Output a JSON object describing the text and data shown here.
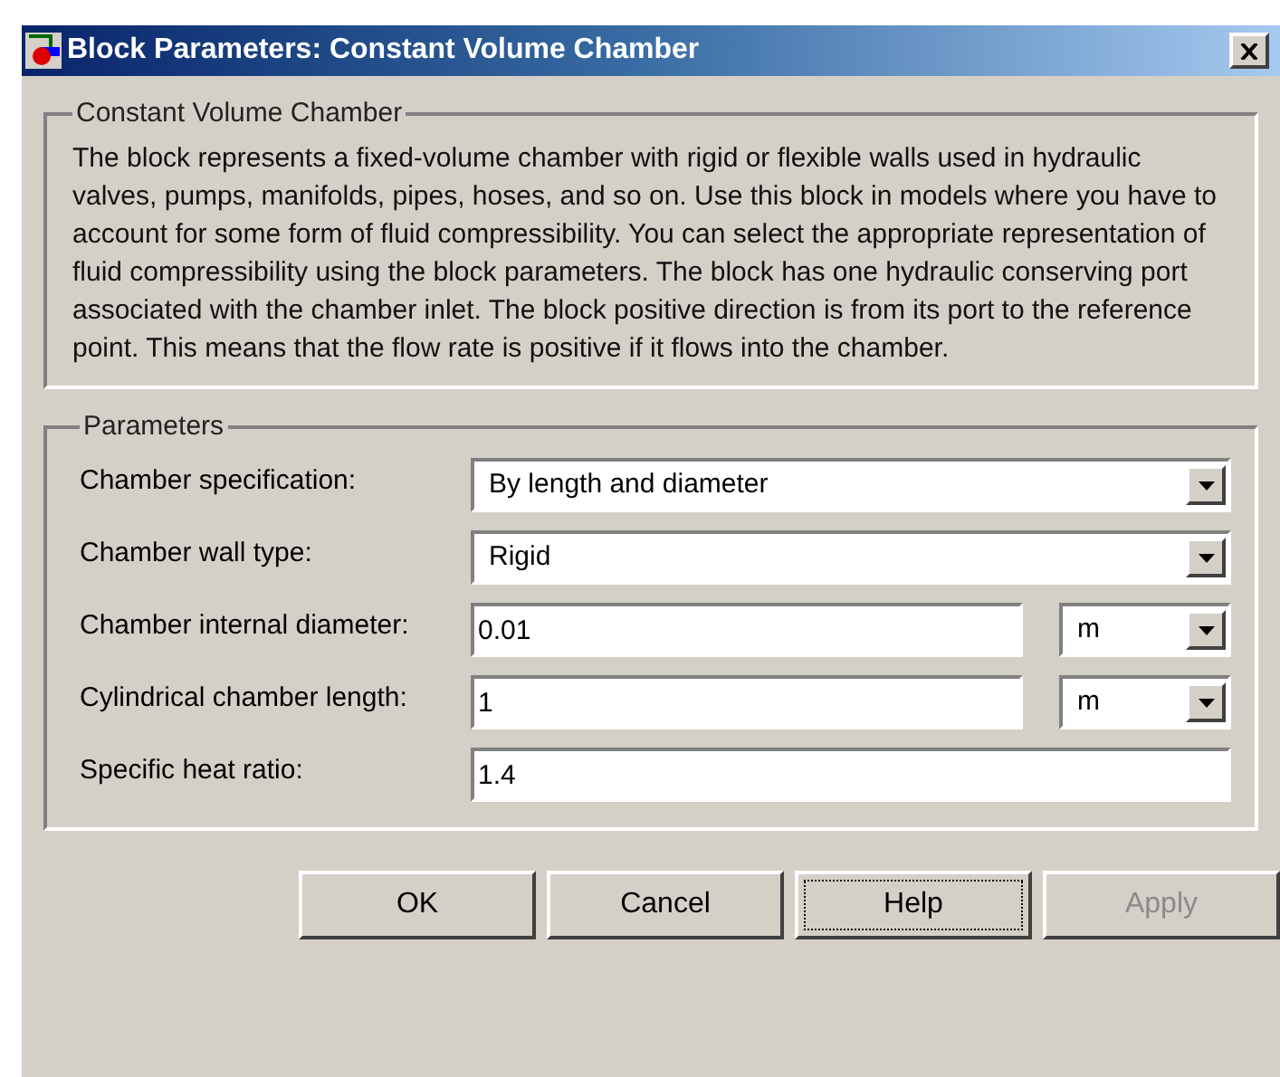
{
  "window": {
    "title": "Block Parameters: Constant Volume Chamber"
  },
  "description": {
    "title": "Constant Volume Chamber",
    "text": "The block represents a fixed-volume chamber with rigid or flexible walls used in hydraulic valves, pumps, manifolds, pipes, hoses, and so on. Use this block in models where you have to account for some form of fluid compressibility. You can select the appropriate representation of fluid compressibility using the block parameters. The block has one hydraulic conserving port associated with the chamber inlet. The block positive direction is from its port to the reference point. This means that the flow rate is positive if it flows into the chamber."
  },
  "parameters": {
    "title": "Parameters",
    "rows": [
      {
        "kind": "dropdown",
        "label": "Chamber specification:",
        "value": "By length and diameter"
      },
      {
        "kind": "dropdown",
        "label": "Chamber wall type:",
        "value": "Rigid"
      },
      {
        "kind": "field_unit",
        "label": "Chamber internal diameter:",
        "value": "0.01",
        "unit": "m"
      },
      {
        "kind": "field_unit",
        "label": "Cylindrical chamber length:",
        "value": "1",
        "unit": "m"
      },
      {
        "kind": "field",
        "label": "Specific heat ratio:",
        "value": "1.4"
      }
    ]
  },
  "buttons": [
    {
      "label": "OK",
      "focused": false,
      "disabled": false
    },
    {
      "label": "Cancel",
      "focused": false,
      "disabled": false
    },
    {
      "label": "Help",
      "focused": true,
      "disabled": false
    },
    {
      "label": "Apply",
      "focused": false,
      "disabled": true
    }
  ]
}
